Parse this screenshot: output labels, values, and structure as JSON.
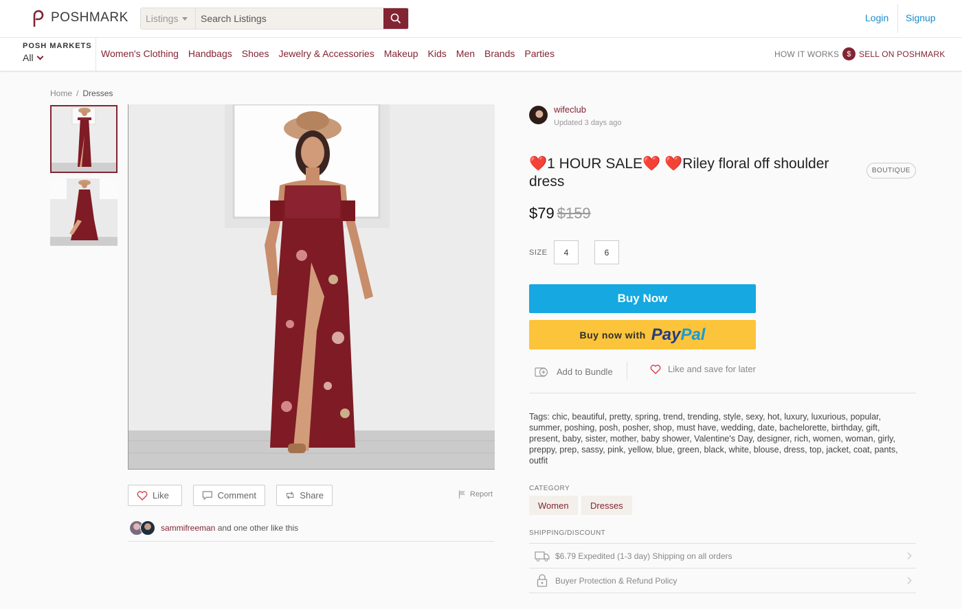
{
  "brand": {
    "name": "POSHMARK",
    "accent": "#822432",
    "link": "#1c8ad1"
  },
  "header": {
    "search_category": "Listings",
    "search_placeholder": "Search Listings",
    "login": "Login",
    "signup": "Signup"
  },
  "nav": {
    "markets_label": "POSH MARKETS",
    "markets_value": "All",
    "categories": [
      "Women's Clothing",
      "Handbags",
      "Shoes",
      "Jewelry & Accessories",
      "Makeup",
      "Kids",
      "Men",
      "Brands",
      "Parties"
    ],
    "how_it_works": "HOW IT WORKS",
    "sell": "SELL ON POSHMARK",
    "sell_icon": "$"
  },
  "breadcrumb": {
    "home": "Home",
    "separator": "/",
    "current": "Dresses"
  },
  "actions": {
    "like": "Like",
    "comment": "Comment",
    "share": "Share",
    "report": "Report"
  },
  "likes": {
    "user": "sammifreeman",
    "rest": "and one other like this"
  },
  "seller": {
    "name": "wifeclub",
    "updated": "Updated 3 days ago"
  },
  "listing": {
    "title": "❤️1 HOUR SALE❤️ ❤️Riley floral off shoulder dress",
    "badge": "BOUTIQUE",
    "price": "$79",
    "original_price": "$159",
    "size_label": "SIZE",
    "sizes": [
      "4",
      "6"
    ],
    "buy_now": "Buy Now",
    "paypal_prefix": "Buy now with",
    "paypal_word_1": "Pay",
    "paypal_word_2": "Pal",
    "add_to_bundle": "Add to Bundle",
    "like_save": "Like and save for later",
    "tags_label": "Tags:",
    "tags": "chic, beautiful, pretty, spring, trend, trending, style, sexy, hot, luxury, luxurious, popular, summer, poshing, posh, posher, shop, must have, wedding, date, bachelorette, birthday, gift, present, baby, sister, mother, baby shower, Valentine's Day, designer, rich, women, woman, girly, preppy, prep, sassy, pink, yellow, blue, green, black, white, blouse, dress, top, jacket, coat, pants, outfit",
    "category_label": "CATEGORY",
    "categories": [
      "Women",
      "Dresses"
    ],
    "shipping_label": "SHIPPING/DISCOUNT",
    "shipping_rows": [
      "$6.79 Expedited (1-3 day) Shipping on all orders",
      "Buyer Protection & Refund Policy"
    ]
  }
}
